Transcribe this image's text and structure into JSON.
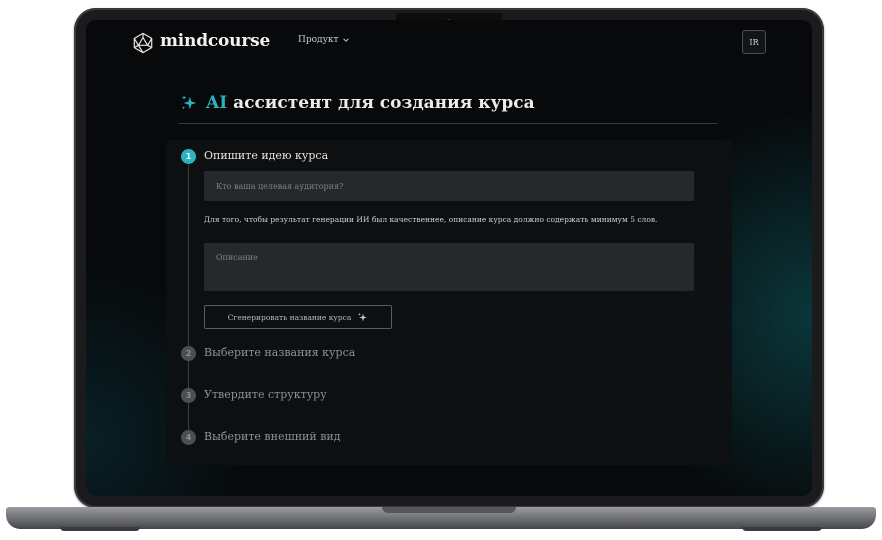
{
  "header": {
    "brand": "mindcourse",
    "nav_product": "Продукт",
    "avatar_initials": "IR"
  },
  "page": {
    "title_accent": "AI",
    "title_rest": "ассистент для создания курса"
  },
  "steps": [
    {
      "number": "1",
      "label": "Опишите идею курса",
      "state": "active"
    },
    {
      "number": "2",
      "label": "Выберите названия курса",
      "state": "idle"
    },
    {
      "number": "3",
      "label": "Утвердите структуру",
      "state": "idle"
    },
    {
      "number": "4",
      "label": "Выберите внешний вид",
      "state": "idle"
    }
  ],
  "form": {
    "audience_placeholder": "Кто ваша целевая аудитория?",
    "hint": "Для того, чтобы результат генерации ИИ был качественнее, описание курса должно содержать минимум 5 слов.",
    "description_placeholder": "Описание",
    "generate_button": "Сгенерировать название курса"
  },
  "icons": {
    "logo": "polyhedron-logo-icon",
    "title": "sparkle-icon",
    "nav": "chevron-down-icon",
    "button": "sparkle-icon"
  },
  "colors": {
    "accent": "#2bb3c0",
    "background": "#07090b",
    "input": "#26292c"
  }
}
